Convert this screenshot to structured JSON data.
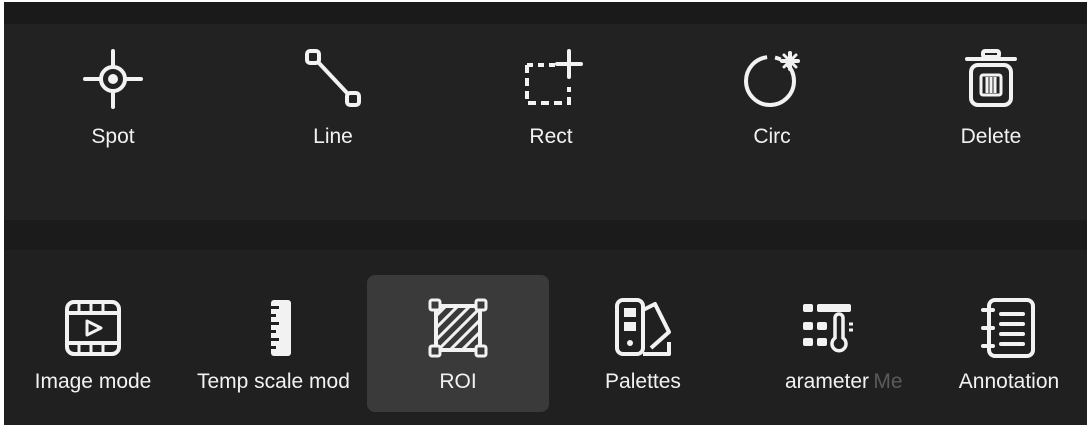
{
  "tools": [
    {
      "id": "spot",
      "label": "Spot",
      "icon": "crosshair-icon"
    },
    {
      "id": "line",
      "label": "Line",
      "icon": "line-icon"
    },
    {
      "id": "rect",
      "label": "Rect",
      "icon": "rect-add-icon"
    },
    {
      "id": "circ",
      "label": "Circ",
      "icon": "circle-add-icon"
    },
    {
      "id": "delete",
      "label": "Delete",
      "icon": "trash-icon"
    }
  ],
  "modes": [
    {
      "id": "image_mode",
      "label": "Image mode",
      "icon": "film-play-icon"
    },
    {
      "id": "temp_scale",
      "label": "Temp scale mod",
      "icon": "ruler-icon"
    },
    {
      "id": "roi",
      "label": "ROI",
      "icon": "roi-icon",
      "selected": true
    },
    {
      "id": "palettes",
      "label": "Palettes",
      "icon": "palette-icon"
    },
    {
      "id": "parameter",
      "label": "arameter",
      "icon": "thermometer-settings-icon"
    },
    {
      "id": "me",
      "label": "Me",
      "icon": "hidden-icon"
    },
    {
      "id": "annotation",
      "label": "Annotation",
      "icon": "notebook-icon"
    }
  ],
  "colors": {
    "background": "#1d1d1d",
    "text": "#f2f2f2",
    "selected_bg": "#3a3a3a"
  }
}
